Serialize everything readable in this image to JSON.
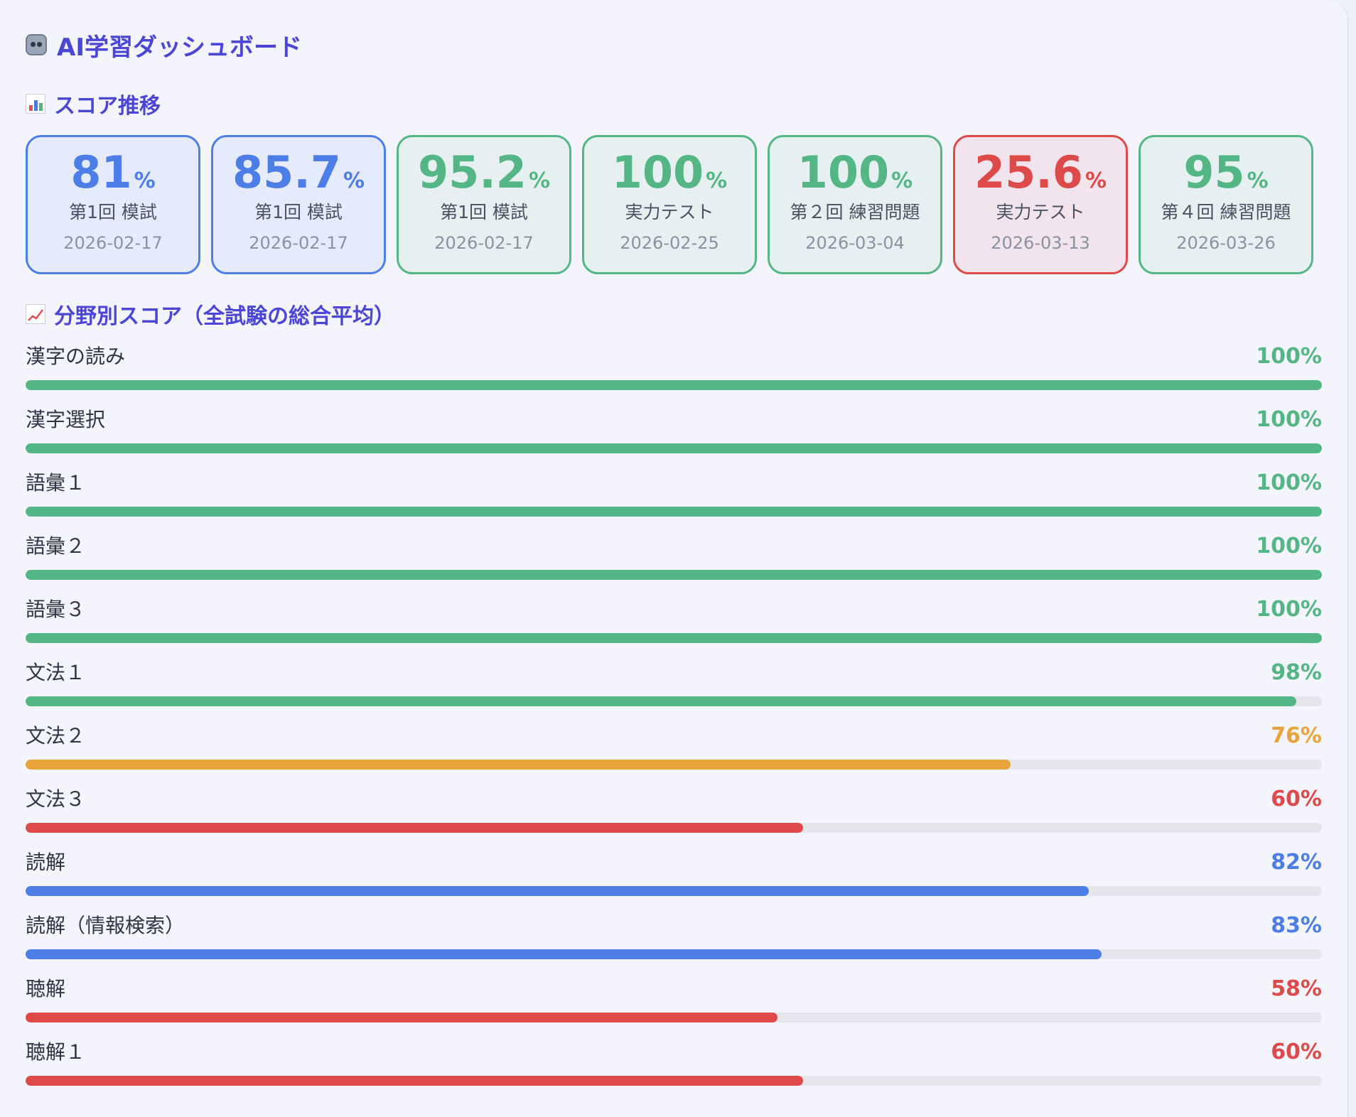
{
  "header": {
    "title": "AI学習ダッシュボード",
    "icon": "robot-icon"
  },
  "score_section": {
    "title": "スコア推移",
    "icon": "bar-chart-icon"
  },
  "colors": {
    "title": "#4b46d6",
    "blue": "#4d7ee8",
    "green": "#55b685",
    "orange": "#e8a33a",
    "red": "#de4a4a",
    "track": "#e4e6ec"
  },
  "score_cards": [
    {
      "score": "81",
      "unit": "%",
      "label": "第1回 模試",
      "date": "2026-02-17",
      "status": "blue"
    },
    {
      "score": "85.7",
      "unit": "%",
      "label": "第1回 模試",
      "date": "2026-02-17",
      "status": "blue"
    },
    {
      "score": "95.2",
      "unit": "%",
      "label": "第1回 模試",
      "date": "2026-02-17",
      "status": "green"
    },
    {
      "score": "100",
      "unit": "%",
      "label": "実力テスト",
      "date": "2026-02-25",
      "status": "green"
    },
    {
      "score": "100",
      "unit": "%",
      "label": "第２回 練習問題",
      "date": "2026-03-04",
      "status": "green"
    },
    {
      "score": "25.6",
      "unit": "%",
      "label": "実力テスト",
      "date": "2026-03-13",
      "status": "red"
    },
    {
      "score": "95",
      "unit": "%",
      "label": "第４回 練習問題",
      "date": "2026-03-26",
      "status": "green"
    }
  ],
  "subject_section": {
    "title": "分野別スコア（全試験の総合平均）",
    "icon": "trend-chart-icon"
  },
  "subjects": [
    {
      "name": "漢字の読み",
      "value": 100,
      "display": "100%",
      "status": "green"
    },
    {
      "name": "漢字選択",
      "value": 100,
      "display": "100%",
      "status": "green"
    },
    {
      "name": "語彙１",
      "value": 100,
      "display": "100%",
      "status": "green"
    },
    {
      "name": "語彙２",
      "value": 100,
      "display": "100%",
      "status": "green"
    },
    {
      "name": "語彙３",
      "value": 100,
      "display": "100%",
      "status": "green"
    },
    {
      "name": "文法１",
      "value": 98,
      "display": "98%",
      "status": "green"
    },
    {
      "name": "文法２",
      "value": 76,
      "display": "76%",
      "status": "orange"
    },
    {
      "name": "文法３",
      "value": 60,
      "display": "60%",
      "status": "red"
    },
    {
      "name": "読解",
      "value": 82,
      "display": "82%",
      "status": "blue"
    },
    {
      "name": "読解（情報検索）",
      "value": 83,
      "display": "83%",
      "status": "blue"
    },
    {
      "name": "聴解",
      "value": 58,
      "display": "58%",
      "status": "red"
    },
    {
      "name": "聴解１",
      "value": 60,
      "display": "60%",
      "status": "red"
    }
  ]
}
